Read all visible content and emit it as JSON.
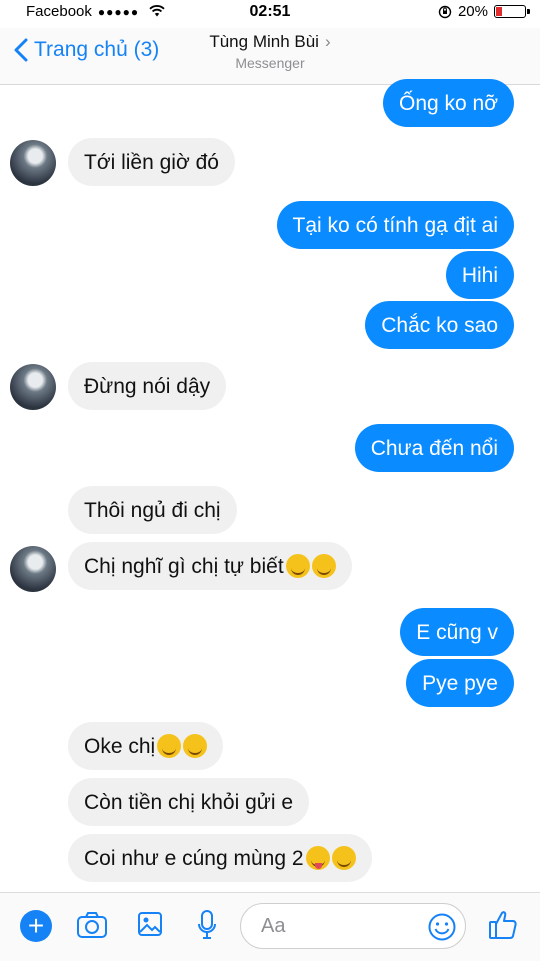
{
  "status_bar": {
    "carrier": "Facebook",
    "signal": "●●●●●",
    "time": "02:51",
    "battery_text": "20%",
    "battery_level": 0.2
  },
  "header": {
    "back_label": "Trang chủ (3)",
    "contact_name": "Tùng Minh Bùi",
    "subtitle": "Messenger"
  },
  "messages": [
    {
      "dir": "out",
      "text": "Ống ko nỡ"
    },
    {
      "dir": "in",
      "text": "Tới liền giờ đó"
    },
    {
      "dir": "out",
      "text": "Tại ko có tính gạ địt ai"
    },
    {
      "dir": "out",
      "text": "Hihi"
    },
    {
      "dir": "out",
      "text": "Chắc ko sao"
    },
    {
      "dir": "in",
      "text": "Đừng nói dậy"
    },
    {
      "dir": "out",
      "text": "Chưa đến nổi"
    },
    {
      "dir": "in",
      "text": "Thôi ngủ đi chị"
    },
    {
      "dir": "in",
      "text": "Chị nghĩ gì chị tự biết",
      "emojis": [
        "relieved-face",
        "relieved-face"
      ]
    },
    {
      "dir": "out",
      "text": "E cũng v"
    },
    {
      "dir": "out",
      "text": "Pye pye"
    },
    {
      "dir": "in",
      "text": "Oke chị",
      "emojis": [
        "relieved-face",
        "relieved-face"
      ]
    },
    {
      "dir": "in",
      "text": "Còn tiền chị khỏi gửi e"
    },
    {
      "dir": "in",
      "text": "Coi như e cúng mùng 2",
      "emojis": [
        "squinting-tongue-face",
        "relieved-face"
      ]
    }
  ],
  "composer": {
    "placeholder": "Aa",
    "icons": [
      "plus-icon",
      "camera-icon",
      "gallery-icon",
      "microphone-icon",
      "emoji-icon",
      "thumbs-up-icon"
    ]
  },
  "colors": {
    "accent": "#1582f6",
    "outgoing_bubble": "#0a8bff",
    "incoming_bubble": "#f0f0f0",
    "battery_low": "#e02c2c"
  }
}
